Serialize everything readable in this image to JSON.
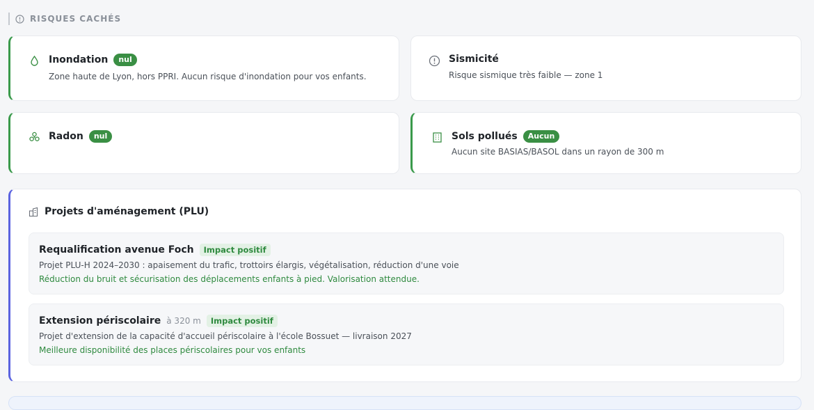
{
  "section": {
    "title": "RISQUES CACHÉS",
    "icon": "info-circle-icon"
  },
  "risks": [
    {
      "title": "Inondation",
      "badge": "nul",
      "description": "Zone haute de Lyon, hors PPRI. Aucun risque d'inondation pour vos enfants.",
      "icon": "water-drop-icon"
    },
    {
      "title": "Sismicité",
      "badge": "",
      "description": "Risque sismique très faible — zone 1",
      "icon": "alert-circle-icon"
    },
    {
      "title": "Radon",
      "badge": "nul",
      "description": "",
      "icon": "radiation-icon"
    },
    {
      "title": "Sols pollués",
      "badge": "Aucun",
      "description": "Aucun site BASIAS/BASOL dans un rayon de 300 m",
      "icon": "building-icon"
    }
  ],
  "plu": {
    "title": "Projets d'aménagement (PLU)",
    "icon": "urban-planning-icon",
    "projects": [
      {
        "title": "Requalification avenue Foch",
        "distance": "",
        "impact": "Impact positif",
        "description": "Projet PLU-H 2024–2030 : apaisement du trafic, trottoirs élargis, végétalisation, réduction d'une voie",
        "effect": "Réduction du bruit et sécurisation des déplacements enfants à pied. Valorisation attendue."
      },
      {
        "title": "Extension périscolaire",
        "distance": "à 320 m",
        "impact": "Impact positif",
        "description": "Projet d'extension de la capacité d'accueil périscolaire à l'école Bossuet — livraison 2027",
        "effect": "Meilleure disponibilité des places périscolaires pour vos enfants"
      }
    ]
  },
  "colors": {
    "green": "#3a8f44",
    "blue_accent": "#5b63e0",
    "muted": "#8a9099"
  }
}
